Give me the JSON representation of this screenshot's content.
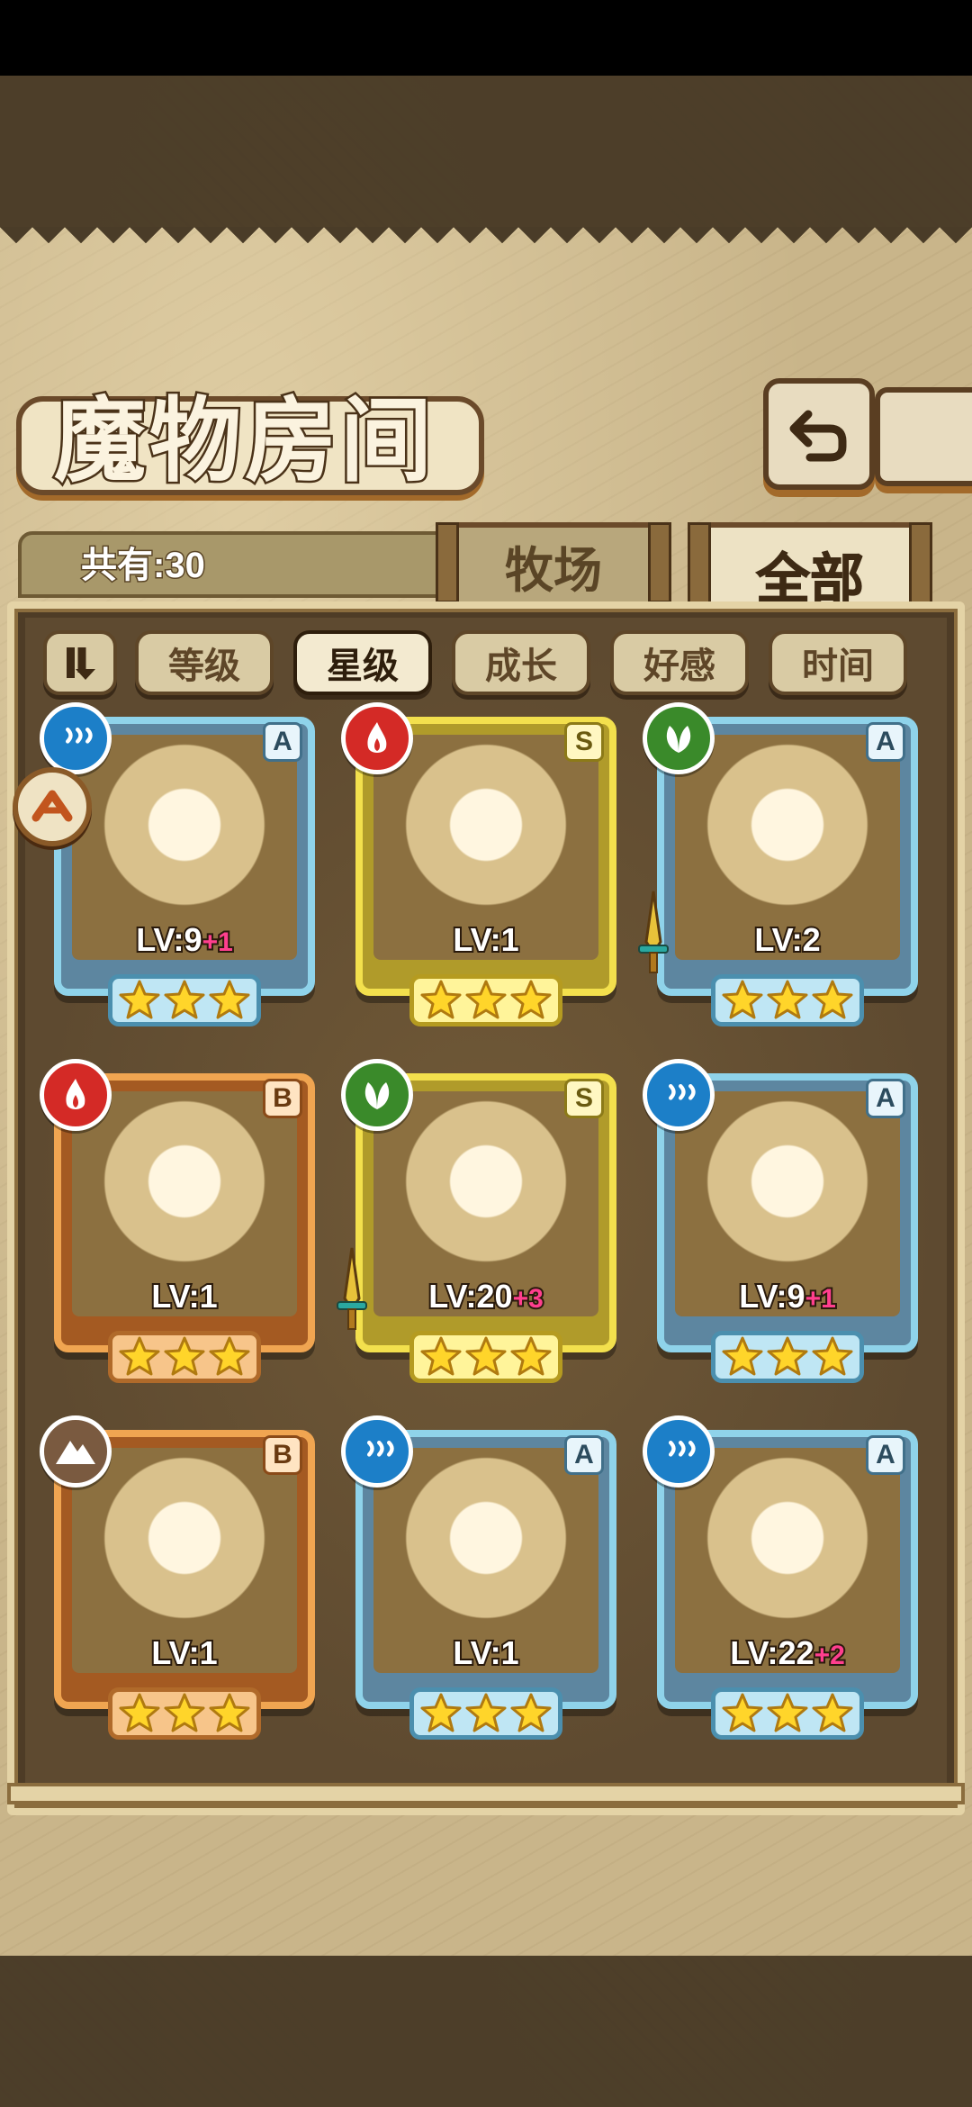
{
  "title": "魔物房间",
  "count_label": "共有:30",
  "tabs": [
    {
      "label": "牧场",
      "active": false
    },
    {
      "label": "全部",
      "active": true
    }
  ],
  "sort_buttons": [
    {
      "label": "等级",
      "active": false
    },
    {
      "label": "星级",
      "active": true
    },
    {
      "label": "成长",
      "active": false
    },
    {
      "label": "好感",
      "active": false
    },
    {
      "label": "时间",
      "active": false
    }
  ],
  "icons": {
    "back": "back-arrow-icon",
    "sort_toggle": "sort-order-icon",
    "skill": "skill-badge-icon",
    "star": "star-icon",
    "weapon": "sword-icon"
  },
  "element_colors": {
    "water": "#1c7fc8",
    "fire": "#d42a26",
    "grass": "#3a8a2a",
    "earth": "#7a5a40"
  },
  "monsters": [
    {
      "rank": "A",
      "element": "water",
      "level": "LV:9",
      "bonus": "+1",
      "stars": 3,
      "has_weapon": false
    },
    {
      "rank": "S",
      "element": "fire",
      "level": "LV:1",
      "bonus": "",
      "stars": 3,
      "has_weapon": false
    },
    {
      "rank": "A",
      "element": "grass",
      "level": "LV:2",
      "bonus": "",
      "stars": 3,
      "has_weapon": true
    },
    {
      "rank": "B",
      "element": "fire",
      "level": "LV:1",
      "bonus": "",
      "stars": 3,
      "has_weapon": false
    },
    {
      "rank": "S",
      "element": "grass",
      "level": "LV:20",
      "bonus": "+3",
      "stars": 3,
      "has_weapon": true
    },
    {
      "rank": "A",
      "element": "water",
      "level": "LV:9",
      "bonus": "+1",
      "stars": 3,
      "has_weapon": false
    },
    {
      "rank": "B",
      "element": "earth",
      "level": "LV:1",
      "bonus": "",
      "stars": 3,
      "has_weapon": false
    },
    {
      "rank": "A",
      "element": "water",
      "level": "LV:1",
      "bonus": "",
      "stars": 3,
      "has_weapon": false
    },
    {
      "rank": "A",
      "element": "water",
      "level": "LV:22",
      "bonus": "+2",
      "stars": 3,
      "has_weapon": false
    }
  ]
}
